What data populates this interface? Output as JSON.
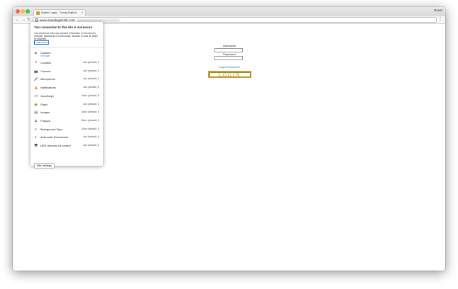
{
  "browser": {
    "tab_title": "Admin Login - Trump Nation",
    "tab_close": "×",
    "profile": "Guest",
    "url": "www.manalegalclub.com",
    "nav_back": "←",
    "nav_forward": "→",
    "nav_reload": "↻",
    "menu": "⋮",
    "info_glyph": "i"
  },
  "login": {
    "username_label": "Username",
    "password_label": "Password",
    "forgot_link": "Forgot Password?",
    "button_label": "LOGIN"
  },
  "popup": {
    "title": "Your connection to this site is not secure",
    "description": "You should not enter any sensitive information on this site (for example, passwords or credit cards), because it could be stolen by attackers.",
    "learn_more": "Learn more",
    "cookies_label": "Cookies",
    "cookies_sub": "19 in use",
    "permissions": [
      {
        "icon": "location-icon",
        "glyph": "📍",
        "label": "Location",
        "value": "Ask (default) ⇕"
      },
      {
        "icon": "camera-icon",
        "glyph": "📷",
        "label": "Camera",
        "value": "Ask (default) ⇕"
      },
      {
        "icon": "microphone-icon",
        "glyph": "🎤",
        "label": "Microphone",
        "value": "Ask (default) ⇕"
      },
      {
        "icon": "bell-icon",
        "glyph": "🔔",
        "label": "Notifications",
        "value": "Ask (default) ⇕"
      },
      {
        "icon": "code-icon",
        "glyph": "</>",
        "label": "JavaScript",
        "value": "Allow (default) ⇕"
      },
      {
        "icon": "puzzle-icon",
        "glyph": "🧩",
        "label": "Flash",
        "value": "Ask (default) ⇕"
      },
      {
        "icon": "image-icon",
        "glyph": "🖼",
        "label": "Images",
        "value": "Allow (default) ⇕"
      },
      {
        "icon": "popup-icon",
        "glyph": "⧉",
        "label": "Popups",
        "value": "Block (default) ⇕"
      },
      {
        "icon": "sync-icon",
        "glyph": "⟳",
        "label": "Background Sync",
        "value": "Allow (default) ⇕"
      },
      {
        "icon": "download-icon",
        "glyph": "⬇",
        "label": "Automatic Downloads",
        "value": "Ask (default) ⇕"
      },
      {
        "icon": "midi-icon",
        "glyph": "🎹",
        "label": "MIDI devices full control",
        "value": "Ask (default) ⇕"
      }
    ],
    "site_settings": "Site settings"
  }
}
